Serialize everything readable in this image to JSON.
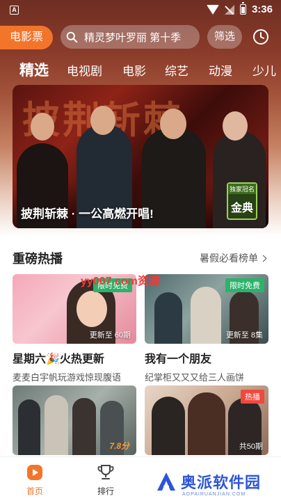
{
  "status_bar": {
    "time": "3:36",
    "app_icon_letter": "A"
  },
  "top_bar": {
    "movie_ticket_label": "电影票",
    "search_placeholder": "精灵梦叶罗丽 第十季",
    "filter_label": "筛选"
  },
  "tabs": [
    "精选",
    "电视剧",
    "电影",
    "综艺",
    "动漫",
    "少儿"
  ],
  "active_tab": "精选",
  "banner": {
    "caption": "披荆斩棘 · 一公高燃开唱!",
    "background_text": "披荆斩棘",
    "badge_top": "独家冠名",
    "badge_main": "金典"
  },
  "section": {
    "title": "重磅热播",
    "more_label": "暑假必看榜单"
  },
  "watermark_top": "yy007.com资源",
  "cards": [
    {
      "title": "星期六🎉火热更新",
      "subtitle": "麦麦白宇帆玩游戏惊现腹语",
      "tag": "限时免费",
      "tag_style": "free",
      "corner": "更新至 60期",
      "score": ""
    },
    {
      "title": "我有一个朋友",
      "subtitle": "纪掌柜又又又给三人画饼",
      "tag": "限时免费",
      "tag_style": "free",
      "corner": "更新至 8集",
      "score": ""
    },
    {
      "title": "",
      "subtitle": "",
      "tag": "",
      "tag_style": "",
      "corner": "",
      "score": "7.8分"
    },
    {
      "title": "",
      "subtitle": "",
      "tag": "热播",
      "tag_style": "hot",
      "corner": "共50期",
      "score": ""
    }
  ],
  "bottom_nav": {
    "home_label": "首页",
    "rank_label": "排行"
  },
  "brand": {
    "name": "奥派软件园",
    "url": "AOPAIRUANJIAN.COM"
  },
  "colors": {
    "accent": "#f2752b",
    "free_tag": "#2bb36b",
    "hot_tag": "#f0483e",
    "brand_blue": "#2c56d6"
  }
}
